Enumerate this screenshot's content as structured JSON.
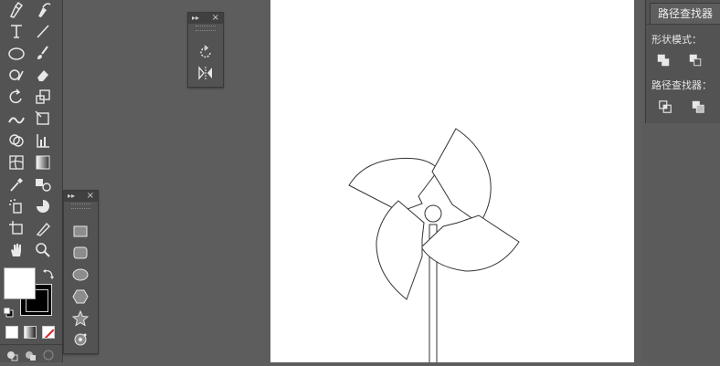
{
  "panels": {
    "pathfinder": {
      "tab_title": "路径查找器",
      "shape_modes_label": "形状模式：",
      "pathfinders_label": "路径查找器："
    }
  },
  "icons": {
    "toolbar": [
      "pen-tool-icon",
      "curvature-tool-icon",
      "type-tool-icon",
      "line-segment-tool-icon",
      "ellipse-tool-icon",
      "paintbrush-tool-icon",
      "shaper-tool-icon",
      "eraser-tool-icon",
      "rotate-tool-icon",
      "scale-tool-icon",
      "width-tool-icon",
      "free-transform-tool-icon",
      "shape-builder-tool-icon",
      "chart-tool-icon",
      "mesh-tool-icon",
      "gradient-tool-icon",
      "eyedropper-tool-icon",
      "blend-tool-icon",
      "symbol-sprayer-tool-icon",
      "pie-graph-tool-icon",
      "artboard-tool-icon",
      "slice-tool-icon",
      "hand-tool-icon",
      "zoom-tool-icon"
    ]
  },
  "colors": {
    "ui_bg": "#5d5d5d",
    "panel_bg": "#535353",
    "artboard": "#ffffff",
    "stroke": "#333333"
  }
}
